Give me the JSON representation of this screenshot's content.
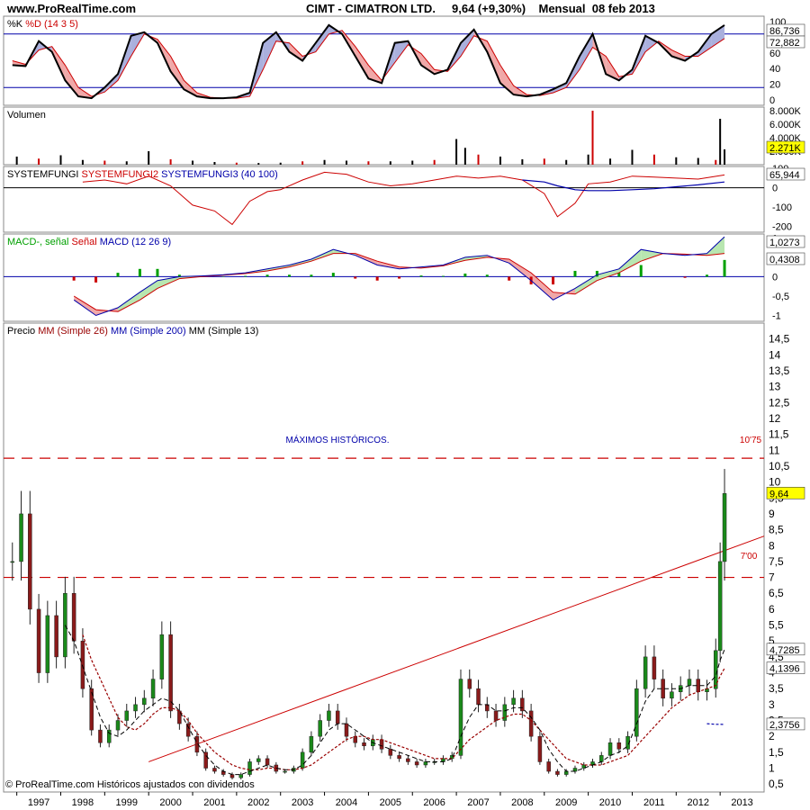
{
  "header": {
    "site": "www.ProRealTime.com",
    "ticker": "CIMT - CIMATRON LTD.",
    "price_change": "9,64 (+9,30%)",
    "period_date": "Mensual  08 feb 2013"
  },
  "copyright": "© ProRealTime.com  Históricos ajustados con dividendos",
  "colors": {
    "red": "#cc0000",
    "blue": "#0000aa",
    "green": "#00a000",
    "black": "#000000",
    "grid": "#8a8a8a",
    "label_bg": "#ffff00"
  },
  "chart_data": [
    {
      "type": "area",
      "panel": "stochastic",
      "title_parts": [
        {
          "text": "%K ",
          "color": "#000000"
        },
        {
          "text": "%D (14 3 5)",
          "color": "#cc0000"
        }
      ],
      "ylim": [
        0,
        100
      ],
      "yticks": [
        "100",
        "80",
        "60",
        "40",
        "20",
        "0"
      ],
      "last_values": [
        "86,736",
        "72,882"
      ],
      "x": [
        1996.9,
        1997.2,
        1997.5,
        1997.8,
        1998.1,
        1998.4,
        1998.7,
        1999.0,
        1999.3,
        1999.6,
        1999.9,
        2000.2,
        2000.5,
        2000.8,
        2001.1,
        2001.4,
        2001.7,
        2002.0,
        2002.3,
        2002.6,
        2002.9,
        2003.2,
        2003.5,
        2003.8,
        2004.1,
        2004.4,
        2004.7,
        2005.0,
        2005.3,
        2005.6,
        2005.9,
        2006.2,
        2006.5,
        2006.8,
        2007.1,
        2007.4,
        2007.7,
        2008.0,
        2008.3,
        2008.6,
        2008.9,
        2009.2,
        2009.5,
        2009.8,
        2010.1,
        2010.4,
        2010.7,
        2011.0,
        2011.3,
        2011.6,
        2011.9,
        2012.2,
        2012.5,
        2012.8,
        2013.1
      ],
      "series": [
        {
          "name": "%K",
          "values": [
            45,
            44,
            72,
            60,
            28,
            10,
            8,
            20,
            35,
            78,
            82,
            70,
            38,
            18,
            10,
            8,
            8,
            9,
            14,
            70,
            82,
            60,
            50,
            70,
            90,
            80,
            55,
            30,
            25,
            70,
            72,
            45,
            35,
            40,
            70,
            85,
            60,
            25,
            12,
            10,
            12,
            18,
            25,
            55,
            80,
            35,
            28,
            40,
            78,
            70,
            55,
            50,
            60,
            80,
            90
          ]
        },
        {
          "name": "%D",
          "values": [
            50,
            46,
            62,
            66,
            45,
            20,
            10,
            15,
            28,
            55,
            80,
            74,
            55,
            28,
            14,
            9,
            8,
            8,
            10,
            40,
            72,
            70,
            55,
            60,
            80,
            84,
            66,
            45,
            28,
            48,
            68,
            58,
            40,
            38,
            55,
            78,
            72,
            45,
            22,
            12,
            11,
            14,
            20,
            40,
            65,
            55,
            32,
            35,
            60,
            72,
            62,
            55,
            55,
            65,
            75
          ]
        }
      ]
    },
    {
      "type": "bar",
      "panel": "volume",
      "title": "Volumen",
      "ylim": [
        0,
        8000
      ],
      "yticks": [
        "8.000K",
        "6.000K",
        "4.000K",
        "2.000K"
      ],
      "last_value": "2.271K",
      "x": [
        1997.0,
        1997.5,
        1998.0,
        1998.5,
        1999.0,
        1999.5,
        2000.0,
        2000.5,
        2001.0,
        2001.5,
        2002.0,
        2002.5,
        2003.0,
        2003.5,
        2004.0,
        2004.5,
        2005.0,
        2005.5,
        2006.0,
        2006.5,
        2007.0,
        2007.2,
        2007.5,
        2008.0,
        2008.5,
        2009.0,
        2009.5,
        2010.0,
        2010.1,
        2010.5,
        2011.0,
        2011.5,
        2012.0,
        2012.5,
        2012.9,
        2013.0,
        2013.1
      ],
      "values": [
        1200,
        900,
        1400,
        700,
        600,
        500,
        2000,
        800,
        600,
        400,
        300,
        250,
        300,
        500,
        700,
        600,
        500,
        500,
        600,
        700,
        3800,
        2500,
        1500,
        1200,
        800,
        900,
        700,
        1500,
        8000,
        900,
        2200,
        1500,
        1100,
        1000,
        700,
        6800,
        2271
      ]
    },
    {
      "type": "line",
      "panel": "systemfungi",
      "title_parts": [
        {
          "text": "SYSTEMFUNGI ",
          "color": "#000000"
        },
        {
          "text": "SYSTEMFUNGI2 ",
          "color": "#cc0000"
        },
        {
          "text": "SYSTEMFUNGI3 (40 100)",
          "color": "#0000aa"
        }
      ],
      "ylim": [
        -230,
        110
      ],
      "yticks": [
        "100",
        "0",
        "-100",
        "-200"
      ],
      "last_value": "65,944",
      "x": [
        1998.5,
        1999.0,
        1999.5,
        2000.0,
        2000.5,
        2001.0,
        2001.5,
        2001.9,
        2002.3,
        2002.7,
        2003.0,
        2003.5,
        2004.0,
        2004.5,
        2005.0,
        2005.5,
        2006.0,
        2006.5,
        2007.0,
        2007.5,
        2008.0,
        2008.5,
        2009.0,
        2009.3,
        2009.7,
        2010.0,
        2010.5,
        2011.0,
        2011.5,
        2012.0,
        2012.5,
        2013.1
      ],
      "series": [
        {
          "name": "SYSTEMFUNGI2",
          "values": [
            30,
            40,
            20,
            60,
            10,
            -90,
            -120,
            -190,
            -70,
            -20,
            -10,
            40,
            80,
            70,
            30,
            10,
            20,
            40,
            60,
            50,
            60,
            40,
            -30,
            -150,
            -80,
            20,
            30,
            60,
            55,
            50,
            45,
            66
          ]
        },
        {
          "name": "SYSTEMFUNGI3",
          "values": [
            null,
            null,
            null,
            null,
            null,
            null,
            null,
            null,
            null,
            null,
            null,
            null,
            null,
            null,
            null,
            null,
            null,
            null,
            null,
            null,
            null,
            40,
            30,
            10,
            -10,
            -15,
            -15,
            -10,
            -5,
            5,
            15,
            30
          ]
        }
      ]
    },
    {
      "type": "bar",
      "panel": "macd",
      "title_parts": [
        {
          "text": "MACD-, señal ",
          "color": "#00a000"
        },
        {
          "text": "Señal ",
          "color": "#cc0000"
        },
        {
          "text": "MACD (12 26 9)",
          "color": "#0000aa"
        }
      ],
      "ylim": [
        -1.15,
        1.1
      ],
      "yticks": [
        "1",
        "0,5",
        "0",
        "-0,5",
        "-1"
      ],
      "last_values": [
        "1,0273",
        "0,4308"
      ],
      "x": [
        1998.3,
        1998.8,
        1999.3,
        1999.8,
        2000.2,
        2000.7,
        2001.2,
        2001.7,
        2002.2,
        2002.7,
        2003.2,
        2003.7,
        2004.2,
        2004.7,
        2005.2,
        2005.7,
        2006.2,
        2006.7,
        2007.2,
        2007.7,
        2008.2,
        2008.7,
        2009.2,
        2009.7,
        2010.2,
        2010.7,
        2011.2,
        2011.7,
        2012.2,
        2012.7,
        2013.1
      ],
      "series": [
        {
          "name": "MACD",
          "values": [
            -0.6,
            -1.0,
            -0.8,
            -0.4,
            -0.1,
            0.0,
            0.02,
            0.05,
            0.1,
            0.2,
            0.3,
            0.45,
            0.7,
            0.55,
            0.3,
            0.2,
            0.25,
            0.3,
            0.5,
            0.55,
            0.35,
            -0.1,
            -0.6,
            -0.3,
            0.05,
            0.2,
            0.7,
            0.6,
            0.55,
            0.6,
            1.0273
          ]
        },
        {
          "name": "Señal",
          "values": [
            -0.5,
            -0.85,
            -0.9,
            -0.6,
            -0.3,
            -0.05,
            0.0,
            0.04,
            0.08,
            0.15,
            0.25,
            0.4,
            0.6,
            0.6,
            0.4,
            0.25,
            0.22,
            0.28,
            0.42,
            0.5,
            0.45,
            0.1,
            -0.4,
            -0.45,
            -0.1,
            0.1,
            0.4,
            0.6,
            0.58,
            0.55,
            0.6
          ]
        },
        {
          "name": "MACD-, señal",
          "values": [
            -0.1,
            -0.15,
            0.1,
            0.2,
            0.2,
            0.05,
            0.02,
            0.01,
            0.02,
            0.05,
            0.05,
            0.05,
            0.1,
            -0.05,
            -0.1,
            -0.05,
            0.03,
            0.02,
            0.08,
            0.05,
            -0.1,
            -0.2,
            -0.2,
            0.15,
            0.15,
            0.1,
            0.3,
            0.0,
            -0.03,
            0.05,
            0.4308
          ]
        }
      ]
    },
    {
      "type": "line",
      "panel": "price",
      "title_parts": [
        {
          "text": "Precio ",
          "color": "#000000"
        },
        {
          "text": "MM (Simple 26) ",
          "color": "#990000"
        },
        {
          "text": "MM (Simple 200) ",
          "color": "#0000aa"
        },
        {
          "text": "MM (Simple 13)",
          "color": "#000000"
        }
      ],
      "xlim": [
        1996.7,
        2014.0
      ],
      "ylim": [
        0.25,
        15.0
      ],
      "yticks": [
        "14,5",
        "14",
        "13,5",
        "13",
        "12,5",
        "12",
        "11,5",
        "11",
        "10,5",
        "10",
        "9,5",
        "9",
        "8,5",
        "8",
        "7,5",
        "7",
        "6,5",
        "6",
        "5,5",
        "5",
        "4,5",
        "4",
        "3,5",
        "3",
        "2,5",
        "2",
        "1,5",
        "1",
        "0,5"
      ],
      "xticks": [
        "1997",
        "1998",
        "1999",
        "2000",
        "2001",
        "2002",
        "2003",
        "2004",
        "2005",
        "2006",
        "2007",
        "2008",
        "2009",
        "2010",
        "2011",
        "2012",
        "2013"
      ],
      "price_labels": [
        "9,64",
        "4,7285",
        "4,1396",
        "2,3756"
      ],
      "annotations": [
        "MÁXIMOS HISTÓRICOS.",
        "10'75",
        "7'00"
      ],
      "hlines": [
        10.75,
        7.0
      ],
      "trendline": {
        "from": [
          2000.0,
          1.2
        ],
        "to": [
          2014.0,
          8.3
        ]
      },
      "x": [
        1996.9,
        1997.1,
        1997.3,
        1997.5,
        1997.7,
        1997.9,
        1998.1,
        1998.3,
        1998.5,
        1998.7,
        1998.9,
        1999.1,
        1999.3,
        1999.5,
        1999.7,
        1999.9,
        2000.1,
        2000.3,
        2000.5,
        2000.7,
        2000.9,
        2001.1,
        2001.3,
        2001.5,
        2001.7,
        2001.9,
        2002.1,
        2002.3,
        2002.5,
        2002.7,
        2002.9,
        2003.1,
        2003.3,
        2003.5,
        2003.7,
        2003.9,
        2004.1,
        2004.3,
        2004.5,
        2004.7,
        2004.9,
        2005.1,
        2005.3,
        2005.5,
        2005.7,
        2005.9,
        2006.1,
        2006.3,
        2006.5,
        2006.7,
        2006.9,
        2007.1,
        2007.3,
        2007.5,
        2007.7,
        2007.9,
        2008.1,
        2008.3,
        2008.5,
        2008.7,
        2008.9,
        2009.1,
        2009.3,
        2009.5,
        2009.7,
        2009.9,
        2010.1,
        2010.3,
        2010.5,
        2010.7,
        2010.9,
        2011.1,
        2011.3,
        2011.5,
        2011.7,
        2011.9,
        2012.1,
        2012.3,
        2012.5,
        2012.7,
        2012.9,
        2013.0,
        2013.1
      ],
      "series": [
        {
          "name": "Precio",
          "values": [
            7.5,
            9.0,
            6.0,
            4.0,
            5.8,
            4.5,
            6.5,
            5.0,
            3.5,
            2.2,
            1.8,
            2.2,
            2.5,
            2.8,
            3.0,
            3.2,
            3.8,
            5.2,
            2.8,
            2.4,
            2.0,
            1.5,
            1.0,
            0.9,
            0.8,
            0.7,
            0.8,
            1.2,
            1.3,
            1.1,
            0.9,
            0.9,
            1.0,
            1.5,
            2.0,
            2.5,
            2.8,
            2.4,
            2.0,
            1.8,
            1.7,
            1.9,
            1.6,
            1.4,
            1.3,
            1.2,
            1.1,
            1.2,
            1.2,
            1.3,
            1.4,
            3.8,
            3.5,
            3.0,
            2.8,
            2.5,
            3.0,
            3.2,
            2.8,
            2.0,
            1.2,
            0.9,
            0.8,
            0.9,
            1.0,
            1.1,
            1.2,
            1.4,
            1.8,
            1.6,
            2.0,
            3.5,
            4.5,
            3.8,
            3.2,
            3.4,
            3.6,
            3.8,
            3.4,
            3.5,
            4.7,
            7.5,
            9.64
          ]
        },
        {
          "name": "MM (Simple 26)",
          "values": [
            null,
            null,
            null,
            null,
            null,
            null,
            null,
            null,
            5.2,
            4.4,
            3.8,
            3.2,
            2.6,
            2.3,
            2.2,
            2.4,
            2.7,
            2.9,
            2.9,
            2.8,
            2.5,
            2.1,
            1.8,
            1.5,
            1.3,
            1.1,
            1.0,
            0.95,
            0.95,
            1.0,
            1.0,
            0.95,
            0.95,
            1.0,
            1.1,
            1.3,
            1.5,
            1.7,
            1.9,
            2.0,
            2.0,
            1.9,
            1.9,
            1.8,
            1.7,
            1.6,
            1.5,
            1.4,
            1.3,
            1.3,
            1.3,
            1.6,
            1.9,
            2.1,
            2.3,
            2.5,
            2.6,
            2.7,
            2.7,
            2.5,
            2.2,
            1.9,
            1.6,
            1.3,
            1.2,
            1.1,
            1.1,
            1.1,
            1.2,
            1.3,
            1.4,
            1.7,
            2.0,
            2.3,
            2.6,
            2.9,
            3.1,
            3.3,
            3.4,
            3.5,
            3.6,
            3.9,
            4.14
          ]
        },
        {
          "name": "MM (Simple 200)",
          "values": [
            null,
            null,
            null,
            null,
            null,
            null,
            null,
            null,
            null,
            null,
            null,
            null,
            null,
            null,
            null,
            null,
            null,
            null,
            null,
            null,
            null,
            null,
            null,
            null,
            null,
            null,
            null,
            null,
            null,
            null,
            null,
            null,
            null,
            null,
            null,
            null,
            null,
            null,
            null,
            null,
            null,
            null,
            null,
            null,
            null,
            null,
            null,
            null,
            null,
            null,
            null,
            null,
            null,
            null,
            null,
            null,
            null,
            null,
            null,
            null,
            null,
            null,
            null,
            null,
            null,
            null,
            null,
            null,
            null,
            null,
            null,
            null,
            null,
            null,
            null,
            null,
            null,
            null,
            null,
            2.4,
            2.38,
            2.38,
            2.3756
          ]
        },
        {
          "name": "MM (Simple 13)",
          "values": [
            null,
            null,
            null,
            null,
            null,
            null,
            5.5,
            5.0,
            4.2,
            3.4,
            2.6,
            2.1,
            2.0,
            2.2,
            2.5,
            2.8,
            3.0,
            3.2,
            3.1,
            2.8,
            2.3,
            1.8,
            1.4,
            1.1,
            0.9,
            0.8,
            0.8,
            0.9,
            1.0,
            1.1,
            1.0,
            0.95,
            0.95,
            1.1,
            1.4,
            1.8,
            2.2,
            2.4,
            2.4,
            2.2,
            2.0,
            1.8,
            1.7,
            1.6,
            1.5,
            1.4,
            1.3,
            1.2,
            1.2,
            1.2,
            1.3,
            2.0,
            2.6,
            3.0,
            3.0,
            2.8,
            2.8,
            2.9,
            2.9,
            2.6,
            2.2,
            1.6,
            1.2,
            0.9,
            0.9,
            1.0,
            1.1,
            1.2,
            1.4,
            1.5,
            1.7,
            2.4,
            3.1,
            3.5,
            3.5,
            3.5,
            3.5,
            3.6,
            3.6,
            3.6,
            3.9,
            4.4,
            4.73
          ]
        }
      ]
    }
  ]
}
